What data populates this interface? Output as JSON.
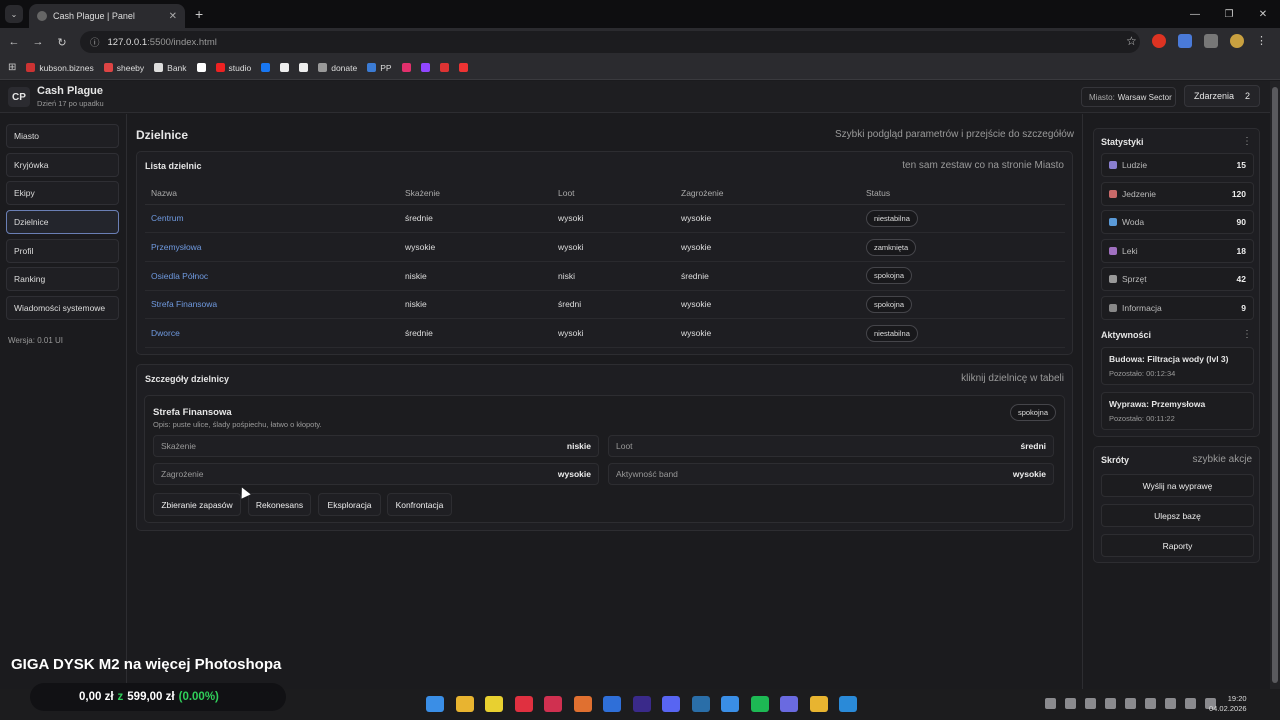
{
  "browser": {
    "tab_title": "Cash Plague | Panel",
    "url_host": "127.0.0.1",
    "url_path": ":5500/index.html",
    "bookmarks": [
      {
        "label": "kubson.biznes",
        "color": "#c33"
      },
      {
        "label": "sheeby",
        "color": "#d44"
      },
      {
        "label": "Bank",
        "color": "#ddd"
      },
      {
        "label": "",
        "color": "#fff"
      },
      {
        "label": "studio",
        "color": "#e22"
      },
      {
        "label": "",
        "color": "#1877f2"
      },
      {
        "label": "",
        "color": "#eee"
      },
      {
        "label": "",
        "color": "#eee"
      },
      {
        "label": "donate",
        "color": "#999"
      },
      {
        "label": "PP",
        "color": "#3b7bd4"
      },
      {
        "label": "",
        "color": "#e1306c"
      },
      {
        "label": "",
        "color": "#9146ff"
      },
      {
        "label": "",
        "color": "#d33"
      },
      {
        "label": "",
        "color": "#e33"
      }
    ]
  },
  "app": {
    "logo": "CP",
    "title": "Cash Plague",
    "subtitle": "Dzień 17 po upadku",
    "city_label": "Miasto:",
    "city_value": "Warsaw Sector",
    "events_label": "Zdarzenia",
    "events_count": "2"
  },
  "sidebar": {
    "items": [
      {
        "label": "Miasto"
      },
      {
        "label": "Kryjówka"
      },
      {
        "label": "Ekipy"
      },
      {
        "label": "Dzielnice"
      },
      {
        "label": "Profil"
      },
      {
        "label": "Ranking"
      },
      {
        "label": "Wiadomości systemowe"
      }
    ],
    "version": "Wersja: 0.01 UI"
  },
  "main": {
    "title": "Dzielnice",
    "subtitle": "Szybki podgląd parametrów i przejście do szczegółów",
    "list": {
      "title": "Lista dzielnic",
      "hint": "ten sam zestaw co na stronie Miasto",
      "columns": [
        "Nazwa",
        "Skażenie",
        "Loot",
        "Zagrożenie",
        "Status"
      ],
      "rows": [
        [
          "Centrum",
          "średnie",
          "wysoki",
          "wysokie",
          "niestabilna"
        ],
        [
          "Przemysłowa",
          "wysokie",
          "wysoki",
          "wysokie",
          "zamknięta"
        ],
        [
          "Osiedla Północ",
          "niskie",
          "niski",
          "średnie",
          "spokojna"
        ],
        [
          "Strefa Finansowa",
          "niskie",
          "średni",
          "wysokie",
          "spokojna"
        ],
        [
          "Dworce",
          "średnie",
          "wysoki",
          "wysokie",
          "niestabilna"
        ]
      ]
    },
    "details": {
      "title": "Szczegóły dzielnicy",
      "hint": "kliknij dzielnicę w tabeli",
      "name": "Strefa Finansowa",
      "desc": "Opis: puste ulice, ślady pośpiechu, łatwo o kłopoty.",
      "status": "spokojna",
      "fields": [
        {
          "label": "Skażenie",
          "value": "niskie"
        },
        {
          "label": "Loot",
          "value": "średni"
        },
        {
          "label": "Zagrożenie",
          "value": "wysokie"
        },
        {
          "label": "Aktywność band",
          "value": "wysokie"
        }
      ],
      "actions": [
        "Zbieranie zapasów",
        "Rekonesans",
        "Eksploracja",
        "Konfrontacja"
      ]
    }
  },
  "right": {
    "stats_title": "Statystyki",
    "stats_menu": "⋮",
    "stats": [
      {
        "label": "Ludzie",
        "value": "15",
        "color": "#8a7fd0"
      },
      {
        "label": "Jedzenie",
        "value": "120",
        "color": "#c96a6a"
      },
      {
        "label": "Woda",
        "value": "90",
        "color": "#5a9ad8"
      },
      {
        "label": "Leki",
        "value": "18",
        "color": "#a070c0"
      },
      {
        "label": "Sprzęt",
        "value": "42",
        "color": "#999"
      },
      {
        "label": "Informacja",
        "value": "9",
        "color": "#888"
      }
    ],
    "activities_title": "Aktywności",
    "activities_menu": "⋮",
    "activities": [
      {
        "title": "Budowa: Filtracja wody (lvl 3)",
        "remaining": "Pozostało: 00:12:34"
      },
      {
        "title": "Wyprawa: Przemysłowa",
        "remaining": "Pozostało: 00:11:22"
      }
    ],
    "shortcuts_title": "Skróty",
    "shortcuts_hint": "szybkie akcje",
    "shortcuts": [
      "Wyślij na wyprawę",
      "Ulepsz bazę",
      "Raporty"
    ]
  },
  "overlay": {
    "promo": "GIGA DYSK M2 na więcej Photoshopa",
    "price_a": "0,00 zł",
    "sep": "z",
    "price_b": "599,00 zł",
    "pct": "(0.00%)"
  },
  "taskbar": {
    "time": "19:20",
    "date": "04.02.2026"
  }
}
